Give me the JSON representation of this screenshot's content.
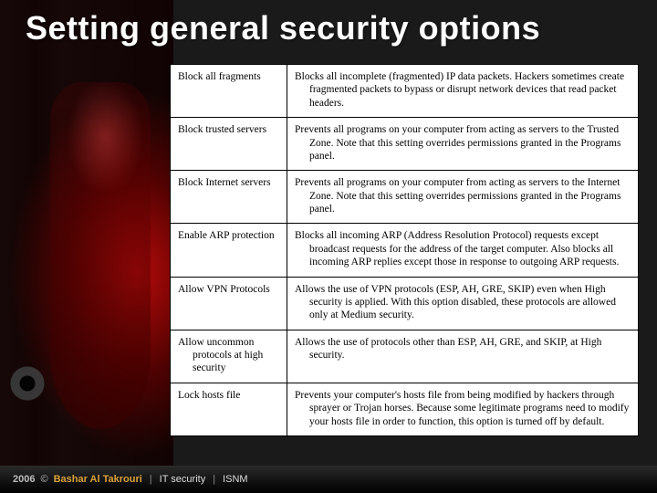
{
  "title": "Setting general security options",
  "rows": [
    {
      "option": "Block all fragments",
      "description": "Blocks all incomplete (fragmented) IP data packets. Hackers sometimes create fragmented packets to bypass or disrupt network devices that read packet headers."
    },
    {
      "option": "Block trusted servers",
      "description": "Prevents all programs on your computer from acting as servers to the Trusted Zone. Note that this setting overrides permissions granted in the Programs panel."
    },
    {
      "option": "Block Internet servers",
      "description": "Prevents all programs on your computer from acting as servers to the Internet Zone. Note that this setting overrides permissions granted in the Programs panel."
    },
    {
      "option": "Enable ARP protection",
      "description": "Blocks all incoming ARP (Address Resolution Protocol) requests except broadcast requests for the address of the target computer. Also blocks all incoming ARP replies except those in response to outgoing ARP requests."
    },
    {
      "option": "Allow VPN Protocols",
      "description": "Allows the use of VPN protocols (ESP, AH, GRE, SKIP) even when High security is applied. With this option disabled, these protocols are allowed only at Medium security."
    },
    {
      "option": "Allow uncommon protocols at high security",
      "description": "Allows the use of protocols other than ESP, AH, GRE, and SKIP, at High security."
    },
    {
      "option": "Lock hosts file",
      "description": "Prevents your computer's hosts file from being modified by hackers through sprayer or Trojan horses. Because some legitimate programs need to modify your hosts file in order to function, this option is turned off by default."
    }
  ],
  "footer": {
    "year": "2006",
    "copyright": "©",
    "author": "Bashar Al Takrouri",
    "sep": "|",
    "course": "IT security",
    "org": "ISNM"
  }
}
